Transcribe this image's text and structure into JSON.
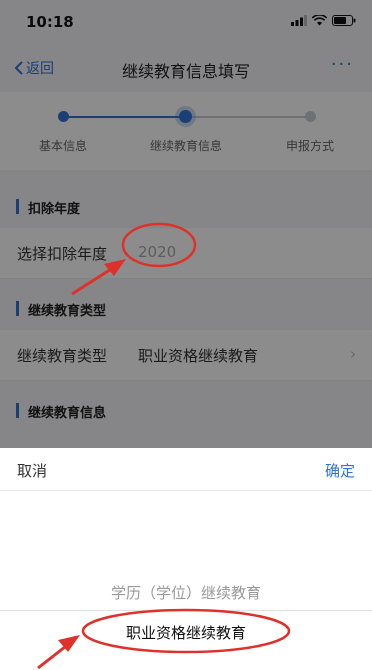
{
  "status_bar": {
    "time": "10:18"
  },
  "nav": {
    "back_label": "返回",
    "title": "继续教育信息填写",
    "more_label": "···"
  },
  "steps": [
    {
      "label": "基本信息",
      "state": "done"
    },
    {
      "label": "继续教育信息",
      "state": "current"
    },
    {
      "label": "申报方式",
      "state": "todo"
    }
  ],
  "sections": {
    "deduction_year": {
      "title": "扣除年度",
      "field_label": "选择扣除年度",
      "field_value": "2020"
    },
    "edu_type": {
      "title": "继续教育类型",
      "field_label": "继续教育类型",
      "field_value": "职业资格继续教育"
    },
    "edu_info": {
      "title": "继续教育信息"
    }
  },
  "picker": {
    "cancel_label": "取消",
    "confirm_label": "确定",
    "options": [
      "学历（学位）继续教育",
      "职业资格继续教育"
    ],
    "selected": "职业资格继续教育"
  },
  "colors": {
    "accent": "#2f73d6",
    "annotation": "#e0302a"
  },
  "icons": [
    "back-chevron-icon",
    "more-icon",
    "signal-icon",
    "wifi-icon",
    "battery-icon",
    "chevron-right-icon"
  ]
}
